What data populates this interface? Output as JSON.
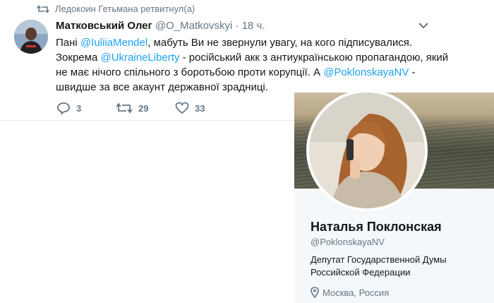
{
  "retweet": {
    "icon": "retweet-icon",
    "text": "Ледокоин Гетьмана ретвитнул(а)"
  },
  "tweet": {
    "author_name": "Матковський Олег",
    "author_handle": "@O_Matkovskyi",
    "separator": "·",
    "time": "18 ч.",
    "text": {
      "t1": "Пані ",
      "m1": "@IuliiaMendel",
      "t2": ", мабуть Ви не звернули увагу, на кого підписувалися. Зокрема ",
      "m2": "@UkraineLiberty",
      "t3": " - російський акк з антиукраїнською пропагандою, який не має нічого спільного з боротьбою проти корупції. А ",
      "m3": "@PoklonskayaNV",
      "t4": " - швидше за все акаунт державної зрадниці."
    },
    "actions": {
      "reply": "3",
      "retweet": "29",
      "like": "33"
    }
  },
  "profile_card": {
    "name": "Наталья Поклонская",
    "handle": "@PoklonskayaNV",
    "bio": "Депутат Государственной Думы Российской Федерации",
    "location": "Москва, Россия"
  },
  "colors": {
    "link": "#1da1f2",
    "muted": "#657786",
    "text": "#14171a"
  }
}
